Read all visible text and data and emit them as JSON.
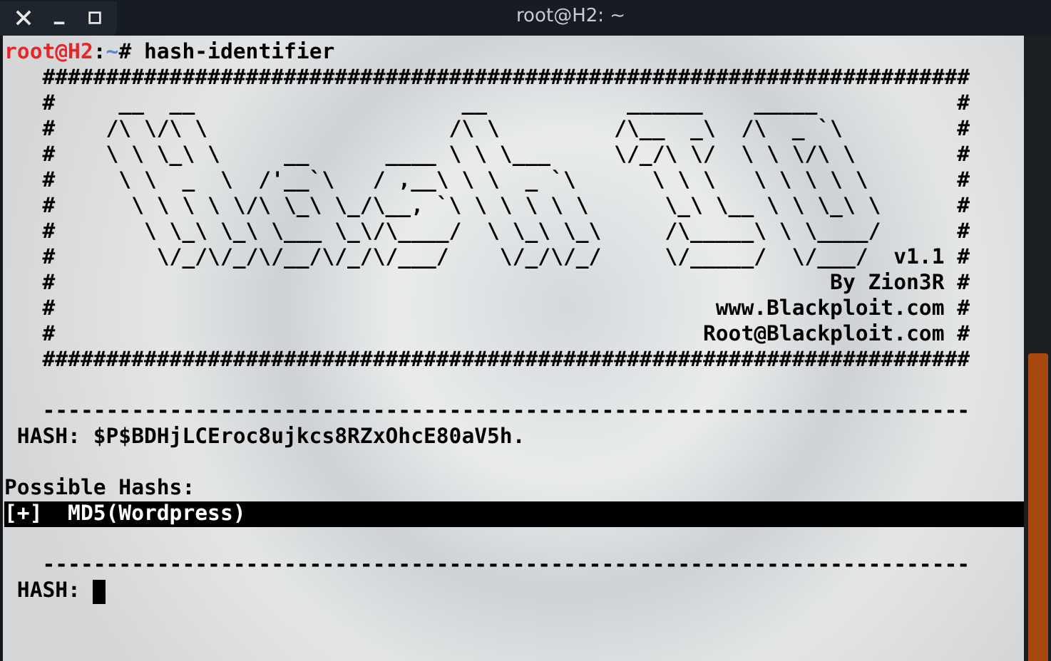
{
  "window": {
    "title": "root@H2: ~"
  },
  "prompt": {
    "user": "root@H2",
    "separator": ":",
    "path": "~",
    "symbol": "#",
    "command": "hash-identifier"
  },
  "banner": [
    "   #########################################################################",
    "   #     __  __                     __           ______    _____           #",
    "   #    /\\ \\/\\ \\                   /\\ \\         /\\__  _\\  /\\  _ `\\         #",
    "   #    \\ \\ \\_\\ \\     __      ____ \\ \\ \\___     \\/_/\\ \\/  \\ \\ \\/\\ \\        #",
    "   #     \\ \\  _  \\  /'__`\\   / ,__\\ \\ \\  _ `\\      \\ \\ \\   \\ \\ \\ \\ \\       #",
    "   #      \\ \\ \\ \\ \\/\\ \\_\\ \\_/\\__, `\\ \\ \\ \\ \\ \\      \\_\\ \\__ \\ \\ \\_\\ \\      #",
    "   #       \\ \\_\\ \\_\\ \\___ \\_\\/\\____/  \\ \\_\\ \\_\\     /\\_____\\ \\ \\____/      #",
    "   #        \\/_/\\/_/\\/__/\\/_/\\/___/    \\/_/\\/_/     \\/_____/  \\/___/  v1.1 #",
    "   #                                                             By Zion3R #",
    "   #                                                    www.Blackploit.com #",
    "   #                                                   Root@Blackploit.com #",
    "   #########################################################################"
  ],
  "separator_1": "   -------------------------------------------------------------------------",
  "hash_line": {
    "label": " HASH:",
    "value": "$P$BDHjLCEroc8ujkcs8RZxOhcE80aV5h."
  },
  "possible_heading": "Possible Hashs:",
  "results": [
    {
      "text": "[+]  MD5(Wordpress)",
      "selected": true
    }
  ],
  "separator_2": "   -------------------------------------------------------------------------",
  "input_prompt": {
    "label": " HASH:"
  }
}
